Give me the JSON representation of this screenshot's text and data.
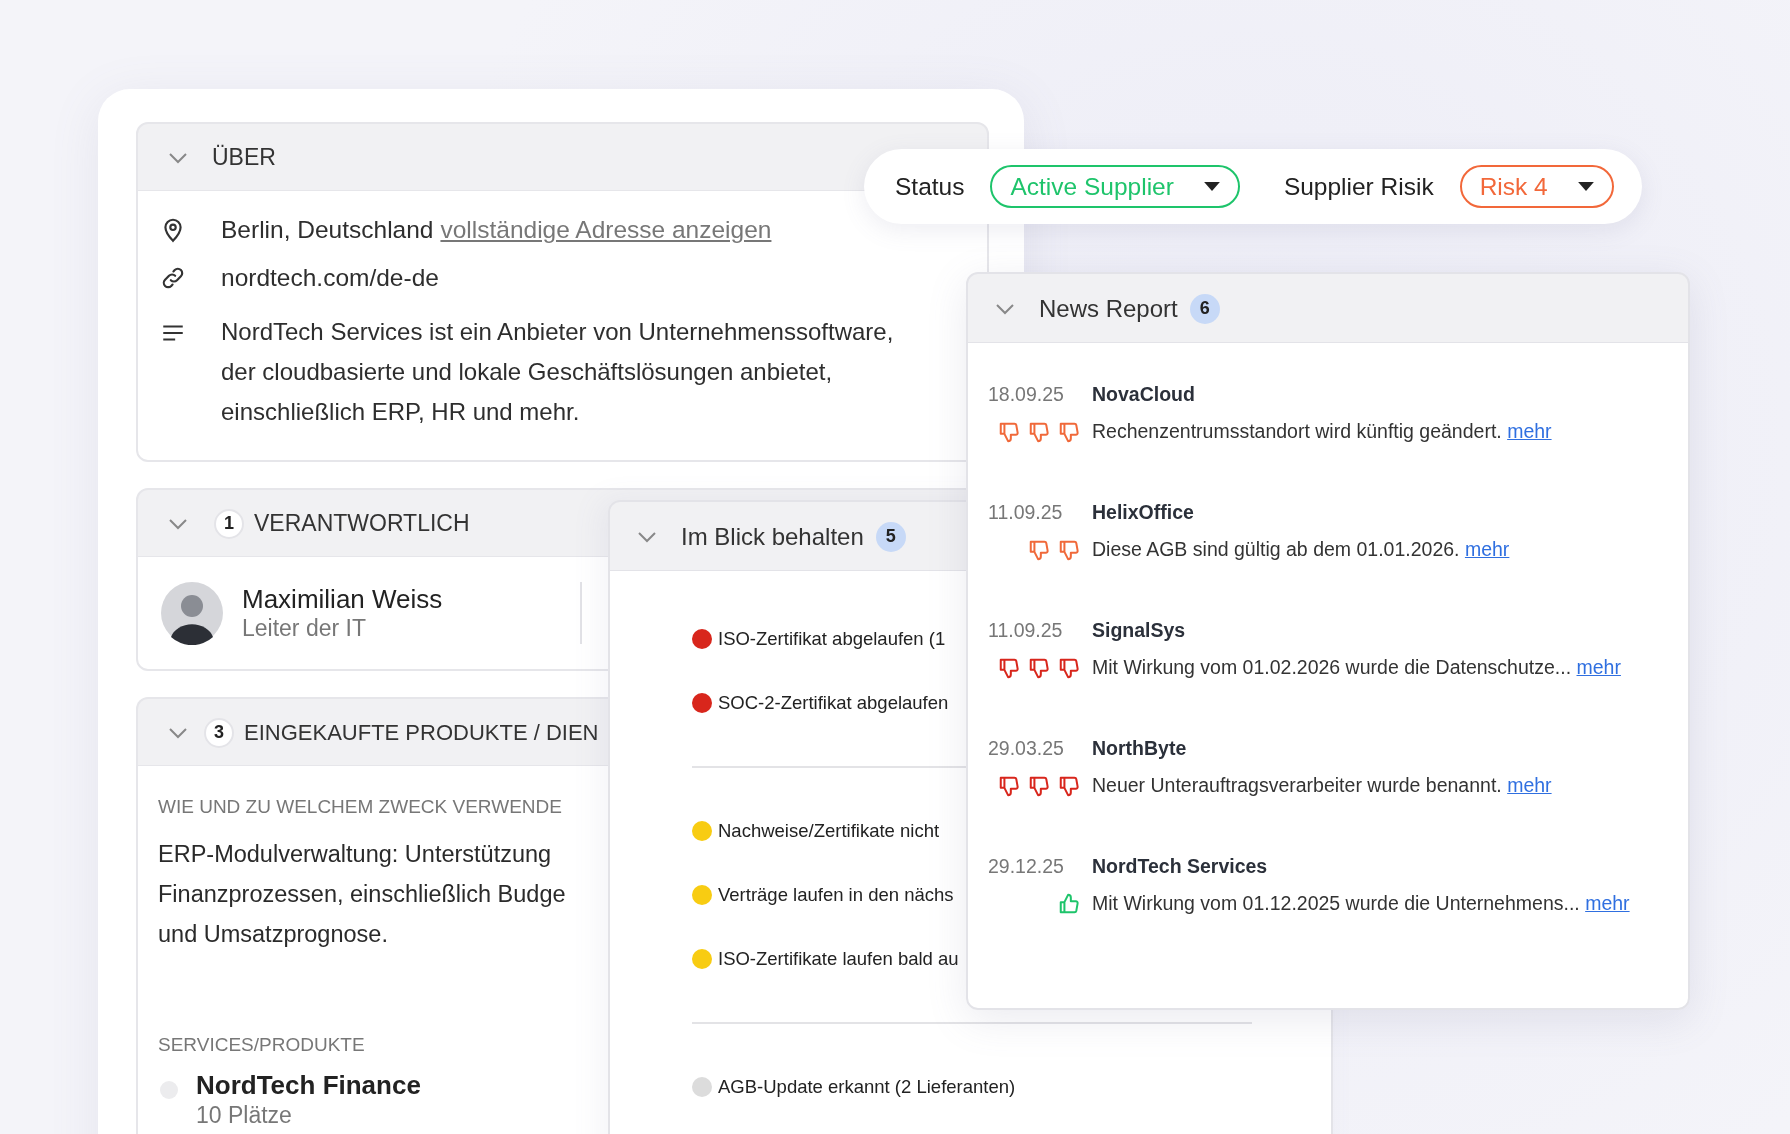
{
  "about": {
    "title": "ÜBER",
    "location": "Berlin, Deutschland",
    "address_link": "vollständige Adresse anzeigen",
    "website": "nordtech.com/de-de",
    "description": "NordTech Services ist ein Anbieter von Unternehmenssoftware, der cloudbasierte und lokale Geschäftslösungen anbietet, einschließlich ERP, HR und mehr."
  },
  "responsible": {
    "count": "1",
    "title": "VERANTWORTLICH",
    "person": {
      "name": "Maximilian Weiss",
      "role": "Leiter der IT"
    }
  },
  "products": {
    "count": "3",
    "title": "EINGEKAUFTE PRODUKTE / DIEN",
    "usage_label": "WIE UND ZU WELCHEM ZWECK VERWENDE",
    "usage_lines": [
      "ERP-Modulverwaltung: Unterstützung",
      "Finanzprozessen, einschließlich Budge",
      "und Umsatzprognose."
    ],
    "services_label": "SERVICES/PRODUKTE",
    "services": [
      {
        "name": "NordTech Finance",
        "detail": "10 Plätze"
      }
    ]
  },
  "selects": [
    {
      "label": "Status",
      "value": "Active Supplier",
      "color": "#1ec46b"
    },
    {
      "label": "Supplier Risik",
      "value": "Risk 4",
      "color": "#f2683a"
    }
  ],
  "watchlist": {
    "title": "Im Blick behalten",
    "count": "5",
    "groups": [
      {
        "items": [
          {
            "text": "ISO-Zertifikat abgelaufen (1",
            "color": "#d8261c"
          },
          {
            "text": "SOC-2-Zertifikat abgelaufen",
            "color": "#d8261c"
          }
        ]
      },
      {
        "items": [
          {
            "text": "Nachweise/Zertifikate nicht",
            "color": "#f8cc12"
          },
          {
            "text": "Verträge laufen in den nächs",
            "color": "#f8cc12"
          },
          {
            "text": "ISO-Zertifikate laufen bald au",
            "color": "#f8cc12"
          }
        ]
      },
      {
        "items": [
          {
            "text": "AGB-Update erkannt (2 Lieferanten)",
            "color": "#dcdcdc"
          }
        ]
      }
    ]
  },
  "news": {
    "title": "News Report",
    "count": "6",
    "items": [
      {
        "date": "18.09.25",
        "company": "NovaCloud",
        "icons": [
          {
            "kind": "down",
            "color": "#f0693a"
          },
          {
            "kind": "down",
            "color": "#f0693a"
          },
          {
            "kind": "down",
            "color": "#f0693a"
          }
        ],
        "text": "Rechenzentrumsstandort wird künftig geändert.",
        "link": "mehr"
      },
      {
        "date": "11.09.25",
        "company": "HelixOffice",
        "icons": [
          {
            "kind": "down",
            "color": "#f0693a"
          },
          {
            "kind": "down",
            "color": "#f0693a"
          }
        ],
        "text": "Diese AGB sind gültig ab dem 01.01.2026.",
        "link": "mehr"
      },
      {
        "date": "11.09.25",
        "company": "SignalSys",
        "icons": [
          {
            "kind": "down",
            "color": "#d8261c"
          },
          {
            "kind": "down",
            "color": "#d8261c"
          },
          {
            "kind": "down",
            "color": "#d8261c"
          }
        ],
        "text": "Mit Wirkung vom 01.02.2026 wurde die Datenschutze...",
        "link": "mehr"
      },
      {
        "date": "29.03.25",
        "company": "NorthByte",
        "icons": [
          {
            "kind": "down",
            "color": "#d8261c"
          },
          {
            "kind": "down",
            "color": "#d8261c"
          },
          {
            "kind": "down",
            "color": "#d8261c"
          }
        ],
        "text": "Neuer Unterauftragsverarbeiter wurde benannt.",
        "link": "mehr"
      },
      {
        "date": "29.12.25",
        "company": "NordTech Services",
        "icons": [
          {
            "kind": "up",
            "color": "#1ec46b"
          }
        ],
        "text": "Mit Wirkung vom 01.12.2025 wurde die Unternehmens...",
        "link": "mehr"
      }
    ]
  }
}
